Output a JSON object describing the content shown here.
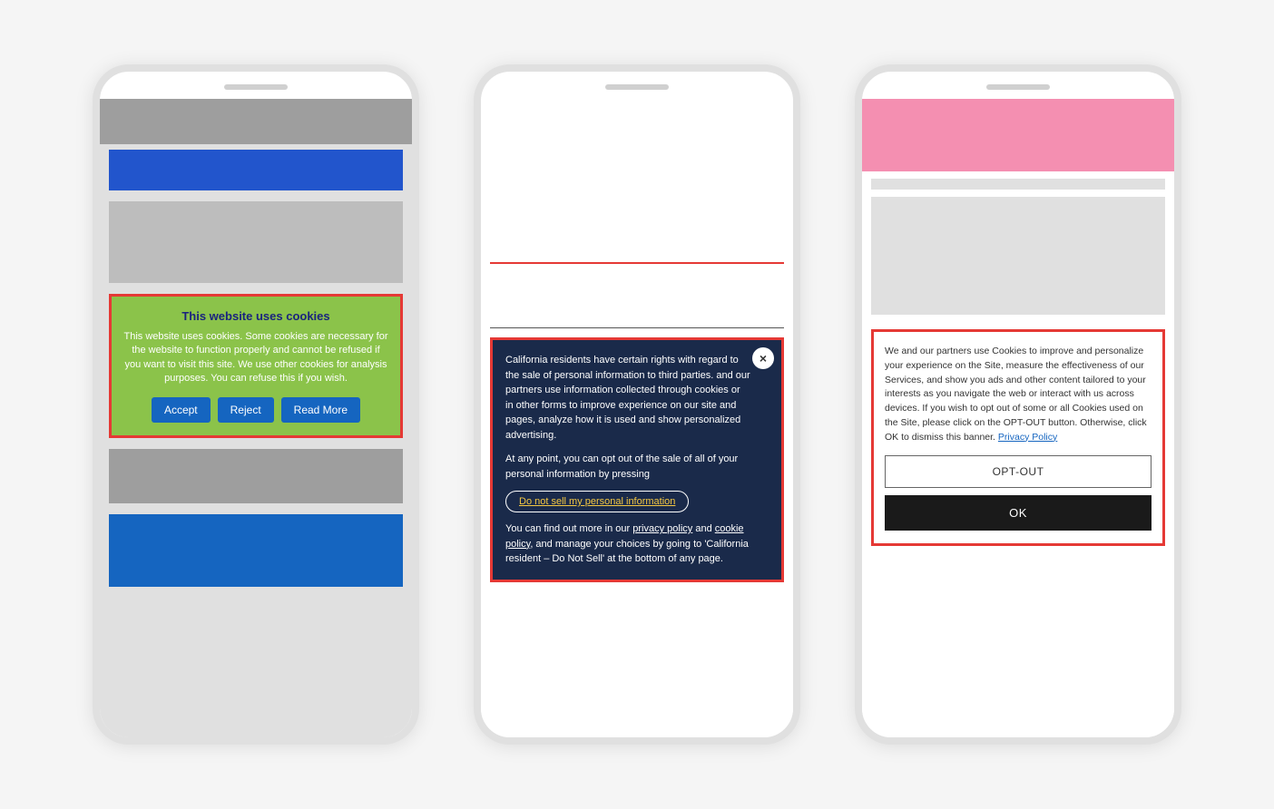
{
  "phone1": {
    "cookie_title": "This website uses cookies",
    "cookie_text": "This website uses cookies. Some cookies are necessary for the website to function properly and cannot be refused if you want to visit this site. We use other cookies for analysis purposes. You can refuse this if you wish.",
    "btn_accept": "Accept",
    "btn_reject": "Reject",
    "btn_read_more": "Read More"
  },
  "phone2": {
    "close_icon": "×",
    "text1": "California residents have certain rights with regard to the sale of personal information to third parties.           and our partners use information collected through cookies or in other forms to improve experience on our site and pages, analyze how it is used and show personalized advertising.",
    "text2": "At any point, you can opt out of the sale of all of your personal information by pressing",
    "opt_out_label": "Do not sell my personal ",
    "opt_out_highlight": "information",
    "text3": "You can find out more in our ",
    "privacy_link": "privacy policy",
    "text4": " and ",
    "cookie_link": "cookie policy",
    "text5": ", and manage your choices by going to 'California resident – Do Not Sell' at the bottom of any page."
  },
  "phone3": {
    "cookie_text": "We and our partners use Cookies to improve and personalize your experience on the Site, measure the effectiveness of our Services, and show you ads and other content tailored to your interests as you navigate the web or interact with us across devices. If you wish to opt out of some or all Cookies used on the Site, please click on the OPT-OUT button. Otherwise, click OK to dismiss this banner.",
    "privacy_link": "Privacy Policy",
    "btn_optout": "OPT-OUT",
    "btn_ok": "OK"
  }
}
